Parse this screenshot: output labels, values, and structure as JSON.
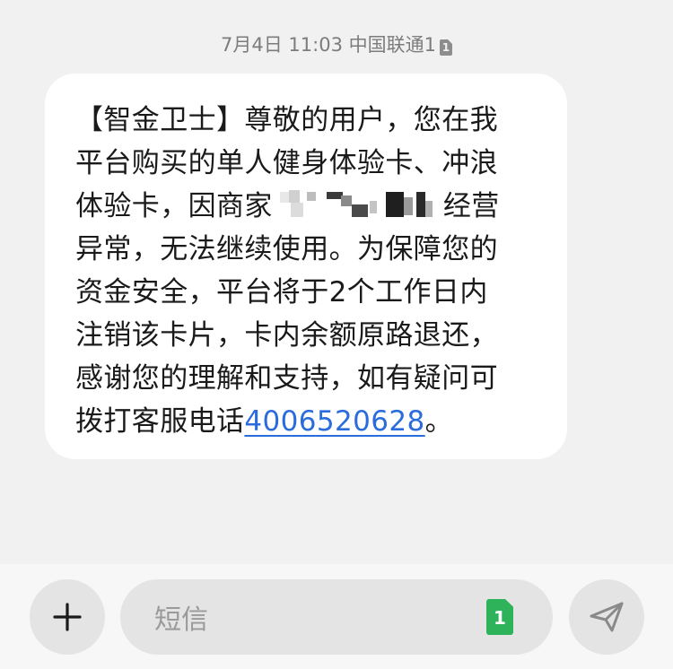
{
  "header": {
    "timestamp": "7月4日 11:03 中国联通1",
    "sim_slot": "1"
  },
  "message": {
    "lines": [
      "【智金卫士】尊敬的用户，您在我",
      "平台购买的单人健身体验卡、冲浪",
      "体验卡，因商家",
      "异常，无法继续使用。为保障您的",
      "资金安全，平台将于2个工作日内",
      "注销该卡片，卡内余额原路退还，",
      "感谢您的理解和支持，如有疑问可",
      "拨打客服电话"
    ],
    "line3_suffix": "经营",
    "phone_number": "4006520628",
    "final_punct": "。"
  },
  "composer": {
    "placeholder": "短信",
    "sim_badge": "1",
    "add_icon": "plus-icon",
    "send_icon": "send-icon"
  },
  "colors": {
    "background": "#f1f1f1",
    "bubble": "#ffffff",
    "link": "#2a6cdc",
    "sim_badge": "#2fb35a"
  }
}
